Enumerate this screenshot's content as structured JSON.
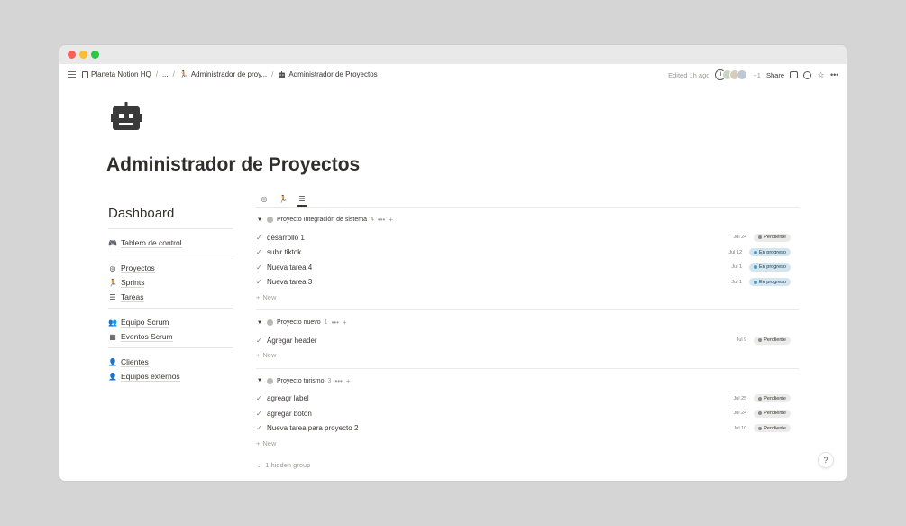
{
  "window": {
    "traffic_lights": [
      "red",
      "yellow",
      "green"
    ]
  },
  "breadcrumbs": [
    {
      "icon": "page-icon",
      "label": "Planeta Notion HQ"
    },
    {
      "label": "..."
    },
    {
      "icon": "runner-icon",
      "label": "Administrador de proy..."
    },
    {
      "icon": "robot-icon",
      "label": "Administrador de Proyectos"
    }
  ],
  "topbar": {
    "edited": "Edited 1h ago",
    "avatar_initial": "I",
    "extra_count": "+1",
    "share": "Share"
  },
  "page": {
    "icon": "robot-icon",
    "title": "Administrador de Proyectos"
  },
  "sidebar": {
    "title": "Dashboard",
    "groups": [
      [
        {
          "icon": "gamepad-icon",
          "label": "Tablero de control"
        }
      ],
      [
        {
          "icon": "target-icon",
          "label": "Proyectos"
        },
        {
          "icon": "runner-icon",
          "label": "Sprints"
        },
        {
          "icon": "checklist-icon",
          "label": "Tareas"
        }
      ],
      [
        {
          "icon": "team-icon",
          "label": "Equipo Scrum"
        },
        {
          "icon": "calendar-icon",
          "label": "Eventos Scrum"
        }
      ],
      [
        {
          "icon": "person-icon",
          "label": "Clientes"
        },
        {
          "icon": "add-person-icon",
          "label": "Equipos externos"
        }
      ]
    ]
  },
  "view_tabs": [
    "target-icon",
    "runner-icon",
    "checklist-icon"
  ],
  "groups": [
    {
      "name": "Proyecto Integración de sistema",
      "count": "4",
      "rows": [
        {
          "title": "desarrollo 1",
          "date": "Jul 24",
          "status": "Pendiente"
        },
        {
          "title": "subir tiktok",
          "date": "Jul 12",
          "status": "En progreso"
        },
        {
          "title": "Nueva tarea 4",
          "date": "Jul 1",
          "status": "En progreso"
        },
        {
          "title": "Nueva tarea 3",
          "date": "Jul 1",
          "status": "En progreso"
        }
      ]
    },
    {
      "name": "Proyecto nuevo",
      "count": "1",
      "rows": [
        {
          "title": "Agregar header",
          "date": "Jul 9",
          "status": "Pendiente"
        }
      ]
    },
    {
      "name": "Proyecto turismo",
      "count": "3",
      "rows": [
        {
          "title": "agreagr label",
          "date": "Jul 25",
          "status": "Pendiente"
        },
        {
          "title": "agregar botón",
          "date": "Jul 24",
          "status": "Pendiente"
        },
        {
          "title": "Nueva tarea para proyecto 2",
          "date": "Jul 10",
          "status": "Pendiente"
        }
      ]
    }
  ],
  "new_label": "New",
  "hidden_group": "1 hidden group",
  "help": "?",
  "colors": {
    "pending_bg": "#ebebea",
    "in_progress_bg": "#d3e5ef",
    "in_progress_dot": "#5b97bd"
  }
}
